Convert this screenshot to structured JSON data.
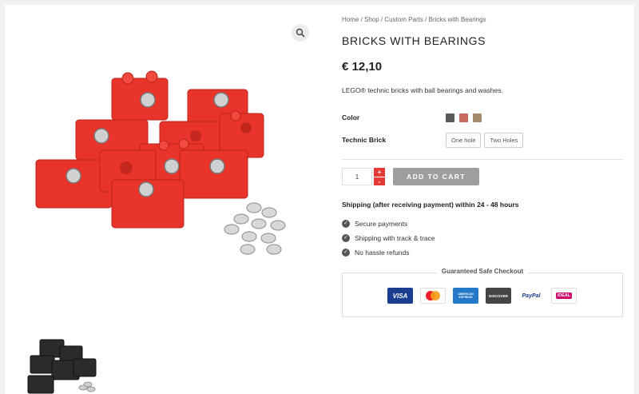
{
  "breadcrumb": {
    "items": [
      "Home",
      "Shop",
      "Custom Parts",
      "Bricks with Bearings"
    ],
    "separator": " / "
  },
  "product": {
    "title": "BRICKS WITH BEARINGS",
    "price": "€ 12,10",
    "description": "LEGO® technic bricks with ball bearings and washes."
  },
  "variations": {
    "color": {
      "label": "Color",
      "swatches": [
        {
          "name": "dark-gray",
          "hex": "#5a5a5a"
        },
        {
          "name": "red",
          "hex": "#c86a5e"
        },
        {
          "name": "tan",
          "hex": "#a68a6e"
        }
      ]
    },
    "technic_brick": {
      "label": "Technic Brick",
      "options": [
        "One hole",
        "Two Holes"
      ]
    }
  },
  "cart": {
    "quantity": "1",
    "plus": "+",
    "minus": "-",
    "add_label": "ADD TO CART"
  },
  "shipping": {
    "text": "Shipping (after receiving payment) within 24 - 48 hours"
  },
  "features": [
    "Secure payments",
    "Shipping with track & trace",
    "No hassle refunds"
  ],
  "checkout": {
    "title": "Guaranteed Safe Checkout",
    "methods": [
      {
        "name": "visa",
        "label": "VISA"
      },
      {
        "name": "mastercard",
        "label": ""
      },
      {
        "name": "american-express",
        "label": "AMERICAN EXPRESS"
      },
      {
        "name": "discover",
        "label": "DISCOVER"
      },
      {
        "name": "paypal",
        "label": "PayPal"
      },
      {
        "name": "ideal",
        "label": "iDEAL"
      }
    ]
  },
  "colors": {
    "accent_red": "#e53935",
    "button_gray": "#9e9e9e",
    "brick_red": "#e8342a"
  },
  "icons": {
    "zoom": "magnifier-icon",
    "feature": "check-circle-icon"
  }
}
